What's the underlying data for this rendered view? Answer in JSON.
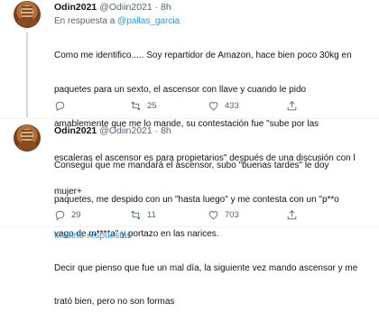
{
  "tweets": [
    {
      "author": {
        "name": "Odin2021",
        "handle": "@Odiin2021",
        "time": "8h"
      },
      "reply_prefix": "En respuesta a ",
      "reply_mention": "@pallas_garcia",
      "lines": [
        "Como me identifico..... Soy repartidor de Amazon, hace bien poco 30kg en",
        "paquetes para un sexto, el ascensor con llave y cuando le pido",
        "amablemente que me lo mande, su contestación fue \"sube por las",
        "escaleras el ascensor es para propietarios\" después de una discusión con l",
        "mujer+"
      ],
      "actions": {
        "replies": "",
        "retweets": "25",
        "likes": "433"
      }
    },
    {
      "author": {
        "name": "Odin2021",
        "handle": "@Odiin2021",
        "time": "8h"
      },
      "lines": [
        "Conseguí que me mandará el ascensor, subo \"buenas tardes\" le doy",
        "paquetes, me despido con un \"hasta luego\" y me contesta con un \"p**o",
        "vago de m****a\" y portazo en las narices.",
        "Decir que pienso que fue un mal día, la siguiente vez mando ascensor y me",
        "trató bien, pero no son formas"
      ],
      "actions": {
        "replies": "29",
        "retweets": "11",
        "likes": "703"
      }
    }
  ],
  "show_more_label": "Mostrar respuestas",
  "header_separator": "·",
  "icons": [
    "reply-icon",
    "retweet-icon",
    "like-icon",
    "share-icon"
  ],
  "colors": {
    "link": "#1d9bf0",
    "muted": "#536471",
    "text": "#0f1419"
  }
}
